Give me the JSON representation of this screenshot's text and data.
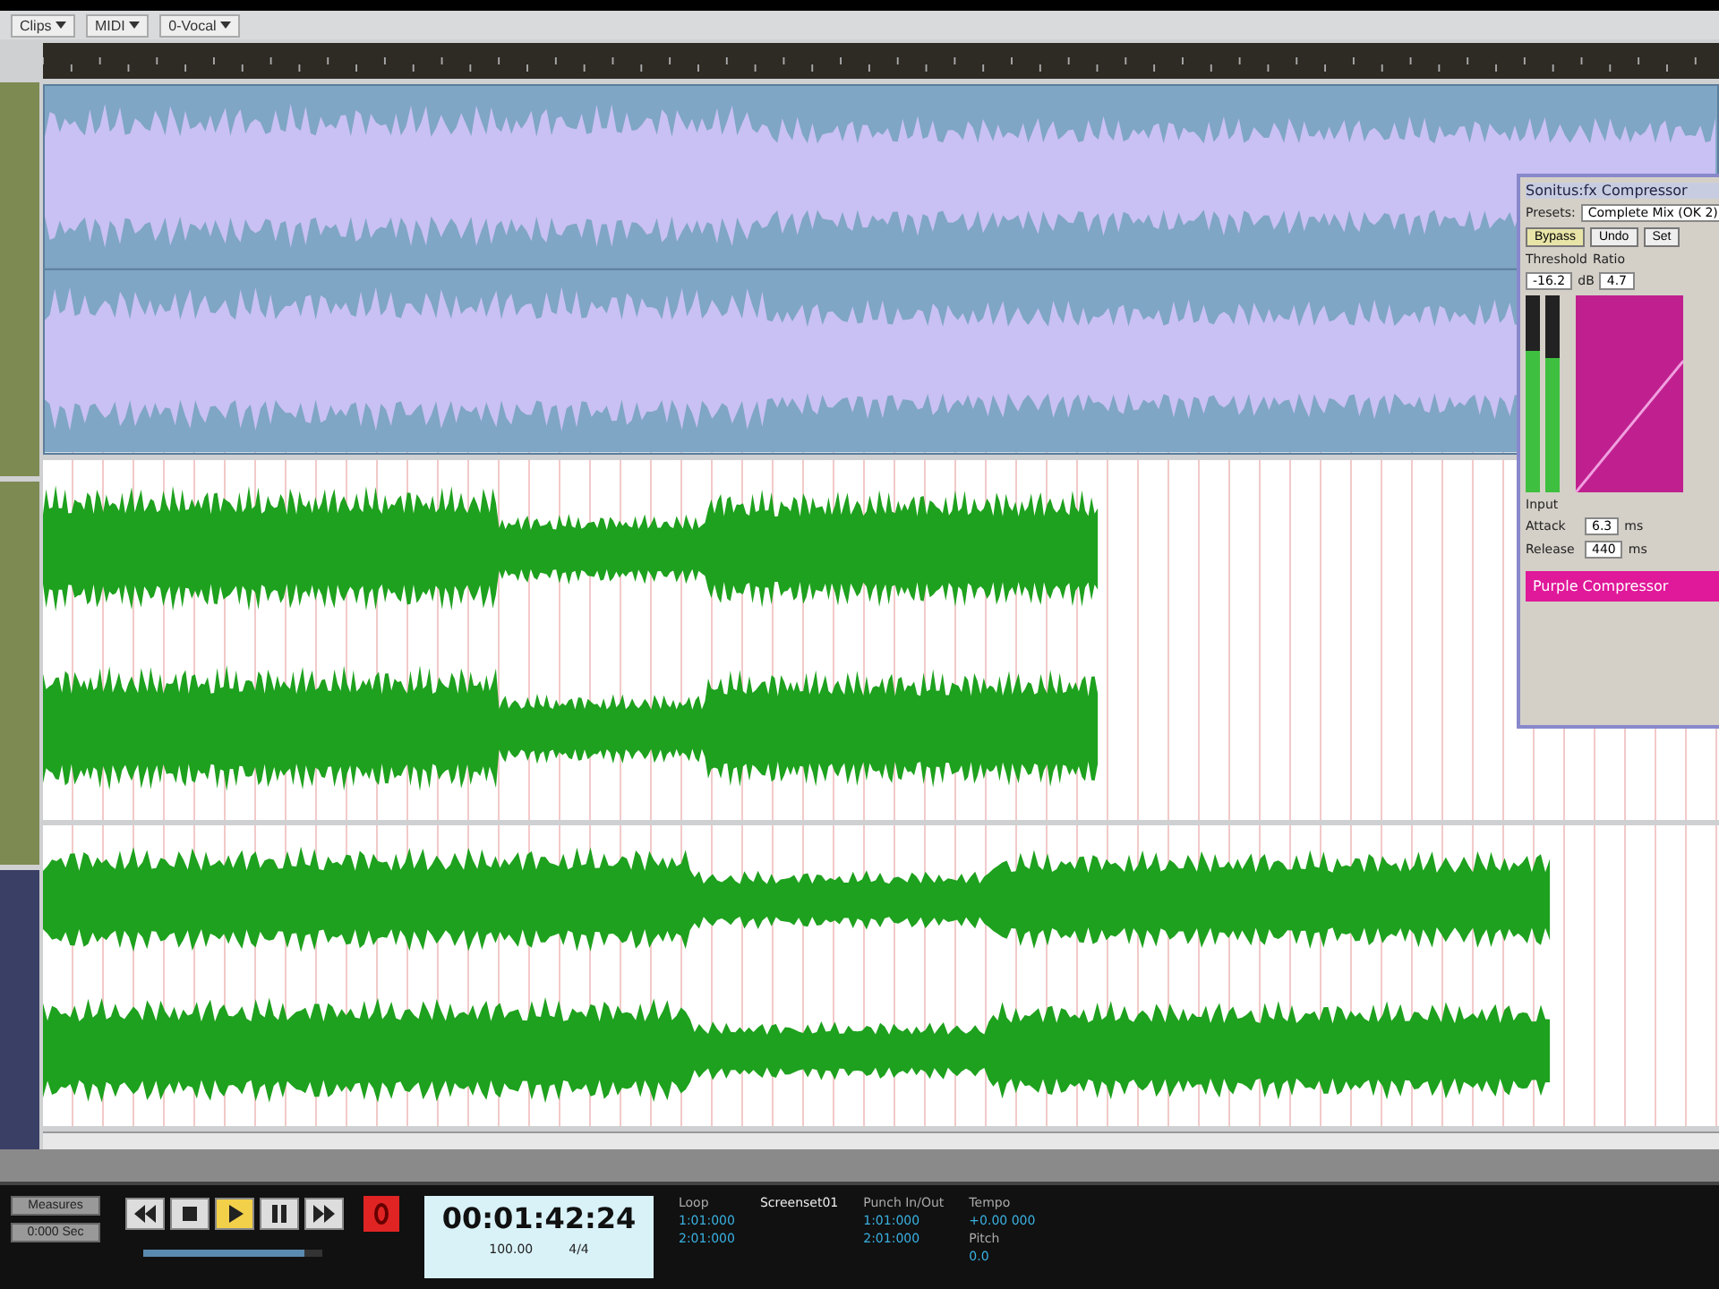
{
  "toolbar": {
    "menus": [
      {
        "label": "Clips"
      },
      {
        "label": "MIDI"
      },
      {
        "label": "0-Vocal"
      }
    ]
  },
  "tracks": [
    {
      "kind": "clip",
      "selected": true
    },
    {
      "kind": "wave",
      "selected": false
    },
    {
      "kind": "wave",
      "selected": false
    }
  ],
  "compressor": {
    "title": "Sonitus:fx Compressor",
    "presets_label": "Presets:",
    "preset": "Complete Mix (OK 2)",
    "buttons": [
      {
        "label": "Bypass",
        "on": true
      },
      {
        "label": "Undo",
        "on": false
      },
      {
        "label": "Set",
        "on": false
      }
    ],
    "threshold_label": "Threshold",
    "threshold": "-16.2",
    "threshold_unit": "dB",
    "ratio_label": "Ratio",
    "ratio": "4.7",
    "meters": [
      {
        "level": 0.72
      },
      {
        "level": 0.68
      }
    ],
    "input_label": "Input",
    "attack_label": "Attack",
    "attack": "6.3",
    "attack_unit": "ms",
    "release_label": "Release",
    "release": "440",
    "release_unit": "ms",
    "footer": "Purple Compressor"
  },
  "transport": {
    "format_buttons": [
      {
        "label": "Measures"
      },
      {
        "label": "0:000 Sec"
      }
    ],
    "controls": [
      {
        "kind": "rewind",
        "on": false
      },
      {
        "kind": "stop",
        "on": false
      },
      {
        "kind": "play",
        "on": true
      },
      {
        "kind": "pause",
        "on": false
      },
      {
        "kind": "forward",
        "on": false
      }
    ],
    "scrub": {
      "level": 0.9
    },
    "record_on": true,
    "time": "00:01:42:24",
    "tempo": "100.00",
    "meter": "4/4",
    "loop_label": "Loop",
    "loop_start": "1:01:000",
    "loop_end": "2:01:000",
    "screenset": "Screenset01",
    "punch_label": "Punch In/Out",
    "punch_start": "1:01:000",
    "punch_end": "2:01:000",
    "tempo_label": "Tempo",
    "tempo_value": "+0.00 000",
    "pitch_label": "Pitch",
    "pitch_value": "0.0"
  }
}
